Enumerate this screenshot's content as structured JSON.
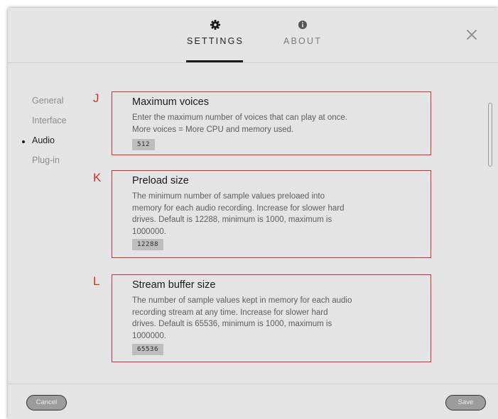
{
  "tabs": [
    {
      "label": "SETTINGS",
      "icon": "gear-icon",
      "active": true
    },
    {
      "label": "ABOUT",
      "icon": "info-icon",
      "active": false
    }
  ],
  "sidebar": {
    "items": [
      {
        "label": "General"
      },
      {
        "label": "Interface"
      },
      {
        "label": "Audio",
        "active": true
      },
      {
        "label": "Plug-in"
      }
    ]
  },
  "settings": [
    {
      "marker": "J",
      "title": "Maximum voices",
      "description": "Enter the maximum number of voices that can play at once. More voices = More CPU and memory used.",
      "value": "512"
    },
    {
      "marker": "K",
      "title": "Preload size",
      "description": "The minimum number of sample values preloaed into memory for each audio recording. Increase for slower hard drives. Default is 12288, minimum is 1000, maximum is 1000000.",
      "value": "12288"
    },
    {
      "marker": "L",
      "title": "Stream buffer size",
      "description": "The number of sample values kept in memory for each audio recording stream at any time. Increase for slower hard drives. Default is 65536, minimum is 1000, maximum is 1000000.",
      "value": "65536"
    }
  ],
  "footer": {
    "cancel_label": "Cancel",
    "save_label": "Save"
  },
  "colors": {
    "panel_bg": "#e4e4e4",
    "annotation_red": "#d32f2f",
    "text_dark": "#1e1e1e",
    "text_muted": "#8c8c8c",
    "field_bg": "#bdbdbd",
    "button_bg": "#9c9c9c"
  }
}
